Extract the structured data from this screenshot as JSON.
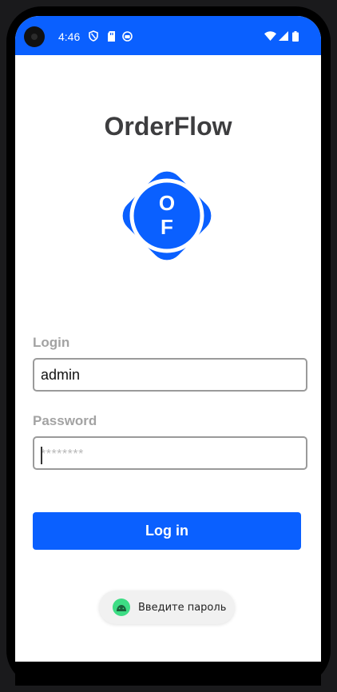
{
  "status_bar": {
    "time": "4:46",
    "icons_left": [
      "shield-icon",
      "sd-card-icon",
      "app-notification-icon"
    ],
    "icons_right": [
      "wifi-icon",
      "cell-signal-icon",
      "battery-icon"
    ],
    "background_color": "#0a60ff"
  },
  "app": {
    "title": "OrderFlow",
    "logo_letters": [
      "O",
      "F"
    ],
    "accent_color": "#0a60ff"
  },
  "login_form": {
    "login_label": "Login",
    "login_value": "admin",
    "password_label": "Password",
    "password_placeholder": "********",
    "submit_label": "Log in"
  },
  "toast": {
    "message": "Введите пароль",
    "icon": "android-icon"
  }
}
